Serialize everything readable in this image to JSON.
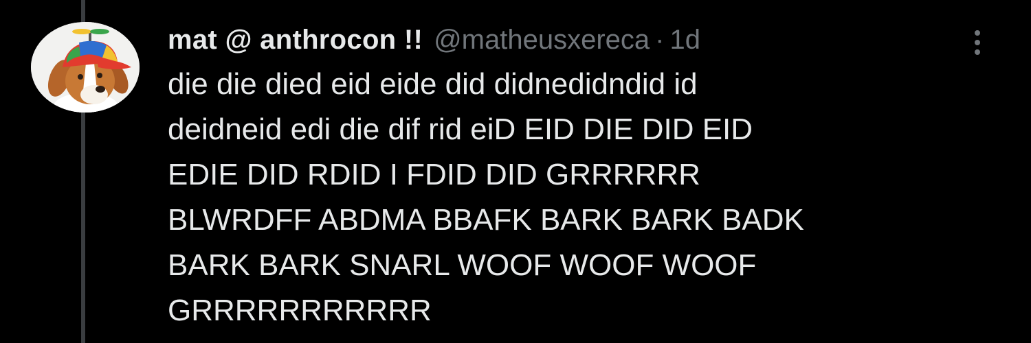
{
  "tweet": {
    "display_name": "mat @ anthrocon !!",
    "handle": "@matheusxereca",
    "separator": "·",
    "time": "1d",
    "avatar_icon": "dog-with-propeller-cap-avatar",
    "more_icon": "vertical-ellipsis-icon",
    "body_lines": [
      "die die died eid eide did didnedidndid id",
      "deidneid edi die dif rid eiD EID DIE DID EID",
      "EDIE DID RDID I FDID DID GRRRRRR",
      "BLWRDFF ABDMA BBAFK BARK BARK BADK",
      "BARK BARK SNARL WOOF WOOF WOOF",
      "GRRRRRRRRRRR"
    ]
  },
  "colors": {
    "background": "#000000",
    "primary_text": "#e7e9ea",
    "secondary_text": "#71767b",
    "thread_line": "#3a3d40"
  }
}
